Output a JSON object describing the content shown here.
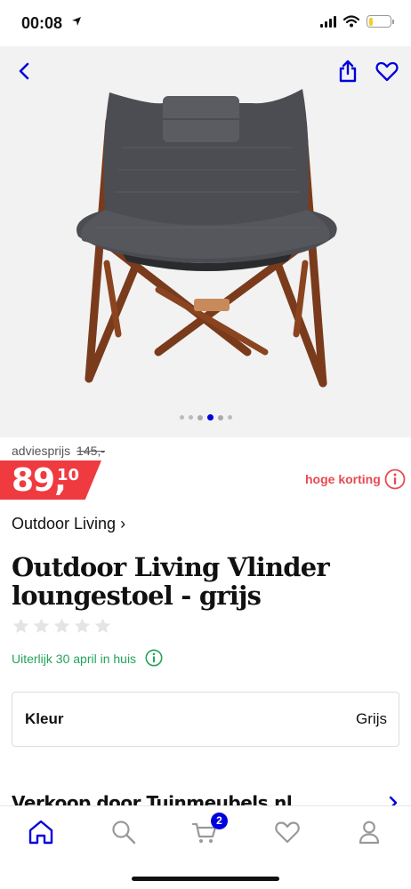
{
  "status": {
    "time": "00:08",
    "battery_level": 0.2
  },
  "product": {
    "advice_label": "adviesprijs",
    "advice_price": "145,-",
    "price_int": "89,",
    "price_dec": "10",
    "discount_label": "hoge korting",
    "brand": "Outdoor Living ›",
    "title": "Outdoor Living Vlinder loungestoel - grijs",
    "rating": 0,
    "rating_max": 5,
    "delivery": "Uiterlijk 30 april in huis",
    "color_label": "Kleur",
    "color_value": "Grijs",
    "seller": "Verkoop door Tuinmeubels.nl",
    "image_count": 6,
    "image_index": 4
  },
  "cart": {
    "count": "2"
  },
  "icons": {
    "back": "chevron-left-icon",
    "share": "share-icon",
    "favorite": "heart-icon",
    "info": "info-icon",
    "home": "home-icon",
    "search": "search-icon",
    "cart": "cart-icon",
    "wishlist": "heart-icon",
    "account": "user-icon"
  },
  "colors": {
    "brand_blue": "#0000dd",
    "price_red": "#ef3a3f",
    "discount_red": "#e84a4f",
    "delivery_green": "#23a35a"
  }
}
